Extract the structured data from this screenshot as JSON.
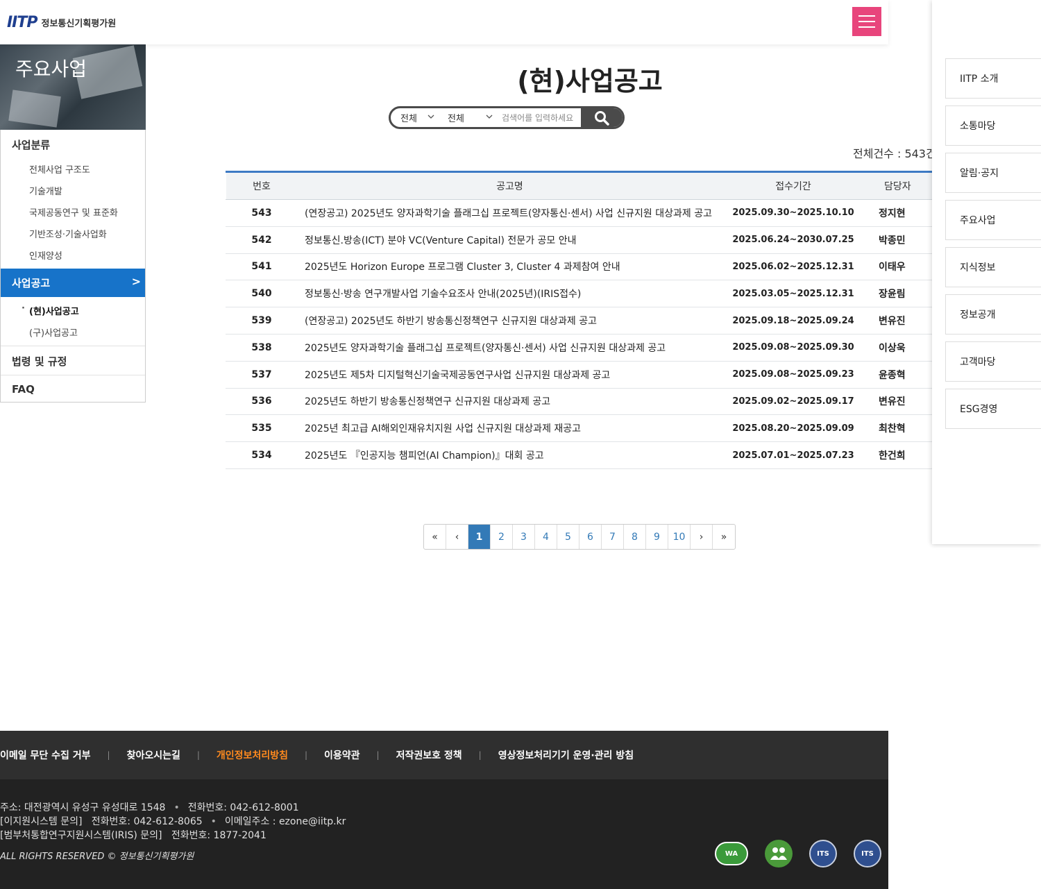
{
  "header": {
    "logo_mark": "IITP",
    "logo_text": "정보통신기획평가원"
  },
  "sidebar": {
    "banner_title": "주요사업",
    "group1": "사업분류",
    "group1_items": [
      "전체사업 구조도",
      "기술개발",
      "국제공동연구 및 표준화",
      "기반조성·기술사업화",
      "인재양성"
    ],
    "active_group": "사업공고",
    "active_arrow": ">",
    "active_items": [
      "(현)사업공고",
      "(구)사업공고"
    ],
    "group3": "법령 및 규정",
    "group4": "FAQ"
  },
  "main": {
    "title": "(현)사업공고",
    "search": {
      "select1": "전체",
      "select2": "전체",
      "placeholder": "검색어를 입력하세요"
    },
    "total": "전체건수 : 543건",
    "columns": [
      "번호",
      "공고명",
      "접수기간",
      "담당자"
    ],
    "rows": [
      {
        "num": "543",
        "title": "(연장공고) 2025년도 양자과학기술 플래그십 프로젝트(양자통신·센서) 사업 신규지원 대상과제 공고",
        "period": "2025.09.30~2025.10.10",
        "manager": "정지현"
      },
      {
        "num": "542",
        "title": "정보통신.방송(ICT) 분야 VC(Venture Capital) 전문가 공모 안내",
        "period": "2025.06.24~2030.07.25",
        "manager": "박종민"
      },
      {
        "num": "541",
        "title": "2025년도 Horizon Europe 프로그램 Cluster 3, Cluster 4 과제참여 안내",
        "period": "2025.06.02~2025.12.31",
        "manager": "이태우"
      },
      {
        "num": "540",
        "title": "정보통신·방송 연구개발사업 기술수요조사 안내(2025년)(IRIS접수)",
        "period": "2025.03.05~2025.12.31",
        "manager": "장윤림"
      },
      {
        "num": "539",
        "title": "(연장공고) 2025년도 하반기 방송통신정책연구 신규지원 대상과제 공고",
        "period": "2025.09.18~2025.09.24",
        "manager": "변유진"
      },
      {
        "num": "538",
        "title": "2025년도 양자과학기술 플래그십 프로젝트(양자통신·센서) 사업 신규지원 대상과제 공고",
        "period": "2025.09.08~2025.09.30",
        "manager": "이상욱"
      },
      {
        "num": "537",
        "title": "2025년도 제5차 디지털혁신기술국제공동연구사업 신규지원 대상과제 공고",
        "period": "2025.09.08~2025.09.23",
        "manager": "윤종혁"
      },
      {
        "num": "536",
        "title": "2025년도 하반기 방송통신정책연구 신규지원 대상과제 공고",
        "period": "2025.09.02~2025.09.17",
        "manager": "변유진"
      },
      {
        "num": "535",
        "title": "2025년 최고급 AI해외인재유치지원 사업 신규지원 대상과제 재공고",
        "period": "2025.08.20~2025.09.09",
        "manager": "최찬혁"
      },
      {
        "num": "534",
        "title": "2025년도 『인공지능 챔피언(AI Champion)』대회 공고",
        "period": "2025.07.01~2025.07.23",
        "manager": "한건희"
      }
    ],
    "pagination": {
      "first": "«",
      "prev": "‹",
      "pages": [
        "1",
        "2",
        "3",
        "4",
        "5",
        "6",
        "7",
        "8",
        "9",
        "10"
      ],
      "next": "›",
      "last": "»",
      "current": "1"
    }
  },
  "right_menu": [
    "IITP 소개",
    "소통마당",
    "알림·공지",
    "주요사업",
    "지식정보",
    "정보공개",
    "고객마당",
    "ESG경영"
  ],
  "footer": {
    "links": [
      "이메일 무단 수집 거부",
      "찾아오시는길",
      "개인정보처리방침",
      "이용약관",
      "저작권보호 정책",
      "영상정보처리기기 운영·관리 방침"
    ],
    "highlight_color": "#ff8a1e",
    "address": "주소: 대전광역시 유성구 유성대로 1548",
    "phone": "전화번호: 042-612-8001",
    "ezone_label": "[이지원시스템 문의]",
    "ezone_phone": "전화번호: 042-612-8065",
    "ezone_email": "이메일주소 : ezone@iitp.kr",
    "iris_label": "[범부처통합연구지원시스템(IRIS) 문의]",
    "iris_phone": "전화번호: 1877-2041",
    "copyright": "ALL RIGHTS RESERVED © 정보통신기획평가원",
    "badges": [
      "WA",
      "PRIVACY",
      "ITS",
      "ITS"
    ]
  },
  "colors": {
    "accent_blue": "#1773c9",
    "menu_pink": "#e8457c",
    "footer_dark": "#222222"
  }
}
